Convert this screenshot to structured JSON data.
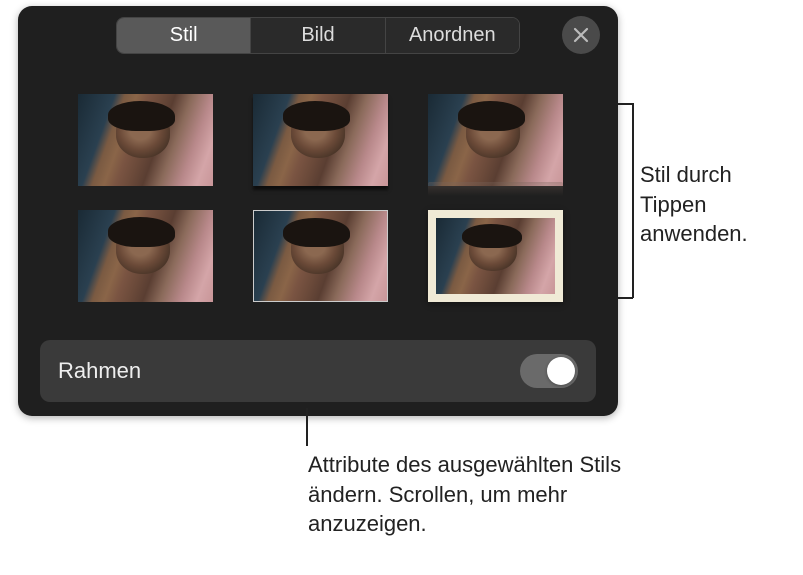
{
  "tabs": {
    "stil": "Stil",
    "bild": "Bild",
    "anordnen": "Anordnen"
  },
  "frame": {
    "label": "Rahmen"
  },
  "callouts": {
    "right": "Stil durch Tippen anwenden.",
    "bottom": "Attribute des ausgewählten Stils ändern. Scrollen, um mehr anzuzeigen."
  },
  "icons": {
    "close": "close-icon"
  }
}
